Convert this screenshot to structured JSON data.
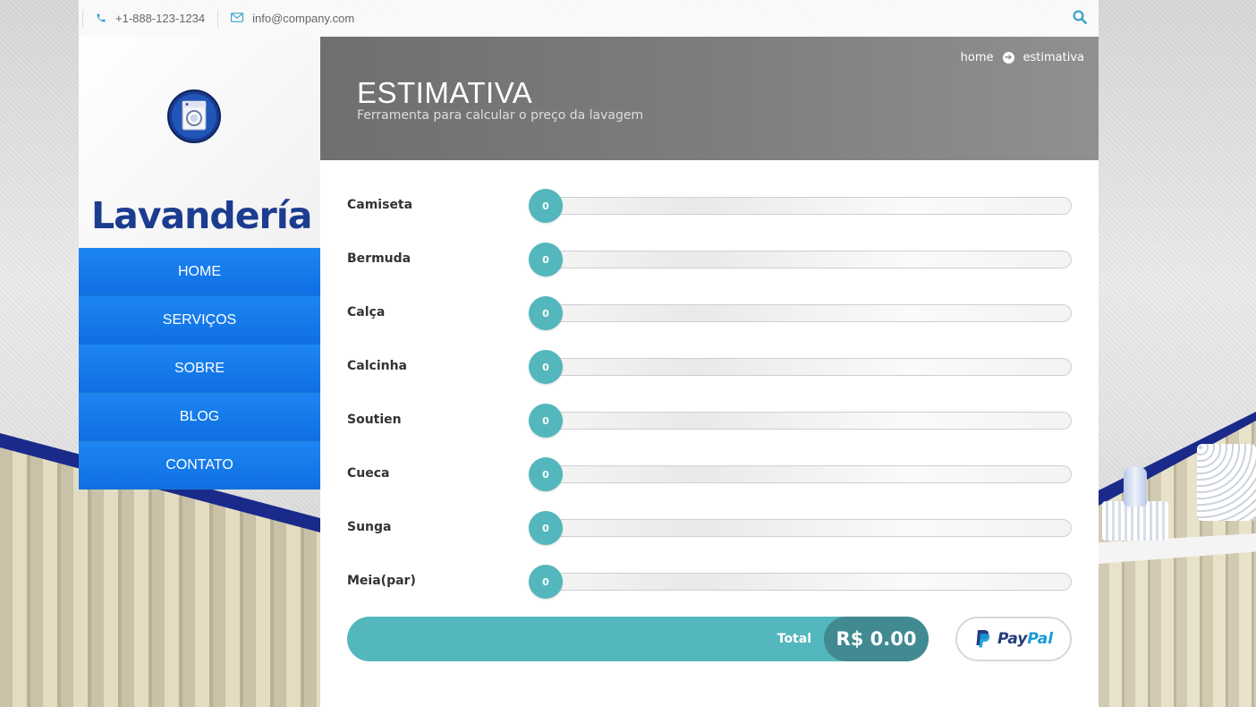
{
  "topbar": {
    "phone": "+1-888-123-1234",
    "email": "info@company.com",
    "icons": {
      "phone": "phone-icon",
      "email": "envelope-icon",
      "search": "search-icon"
    },
    "accent": "#3aa3c8"
  },
  "brand": {
    "name": "Lavandería",
    "logo_icon": "washing-machine-icon",
    "color": "#1b3c8f"
  },
  "nav": {
    "items": [
      {
        "label": "HOME"
      },
      {
        "label": "SERVIÇOS"
      },
      {
        "label": "SOBRE"
      },
      {
        "label": "BLOG"
      },
      {
        "label": "CONTATO"
      }
    ],
    "color": "#1d86f2"
  },
  "header": {
    "title": "ESTIMATIVA",
    "subtitle": "Ferramenta para calcular o preço da lavagem",
    "breadcrumb": {
      "home": "home",
      "current": "estimativa",
      "separator_icon": "arrow-right-circle-icon"
    }
  },
  "estimator": {
    "items": [
      {
        "label": "Camiseta",
        "value": "0"
      },
      {
        "label": "Bermuda",
        "value": "0"
      },
      {
        "label": "Calça",
        "value": "0"
      },
      {
        "label": "Calcinha",
        "value": "0"
      },
      {
        "label": "Soutien",
        "value": "0"
      },
      {
        "label": "Cueca",
        "value": "0"
      },
      {
        "label": "Sunga",
        "value": "0"
      },
      {
        "label": "Meia(par)",
        "value": "0"
      }
    ],
    "handle_color": "#53b7bd",
    "total_label": "Total",
    "total_value": "R$ 0.00",
    "paypal": {
      "pay": "Pay",
      "pal": "Pal",
      "icon": "paypal-logo-icon"
    }
  }
}
